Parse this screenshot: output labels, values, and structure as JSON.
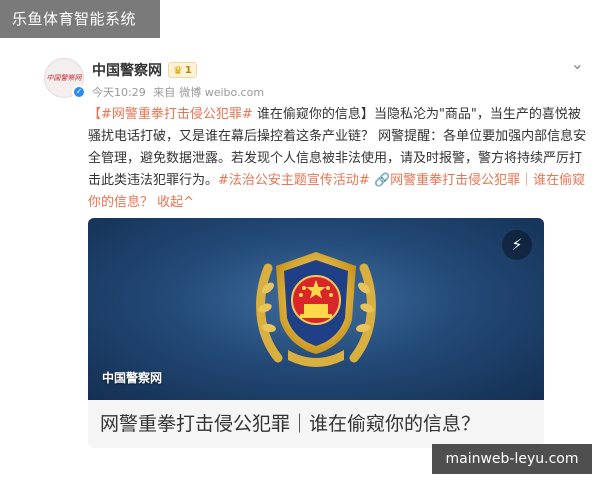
{
  "watermark_top": "乐鱼体育智能系统",
  "watermark_bottom": "mainweb-leyu.com",
  "post": {
    "author": "中国警察网",
    "avatar_logo_text": "中国警察网",
    "badge_text": "1",
    "time": "今天10:29",
    "source_prefix": "来自",
    "source": "微博 weibo.com",
    "body": {
      "hashtag1": "【#网警重拳打击侵公犯罪#",
      "headline": " 谁在偷窥你的信息】",
      "text1": "当隐私沦为\"商品\"，当生产的喜悦被骚扰电话打破，又是谁在幕后操控着这条产业链？ 网警提醒：各单位要加强内部信息安全管理，避免数据泄露。若发现个人信息被非法使用，请及时报警，警方将持续严厉打击此类违法犯罪行为。",
      "hashtag2": "#法治公安主题宣传活动#",
      "link_text": "🔗网警重拳打击侵公犯罪｜谁在偷窥你的信息？",
      "collapse": "收起^"
    },
    "media": {
      "caption": "中国警察网"
    },
    "link_card_title": "网警重拳打击侵公犯罪｜谁在偷窥你的信息？"
  },
  "colors": {
    "accent": "#eb7350",
    "verified": "#2a8cf0",
    "media_bg": "#234a78"
  },
  "icons": {
    "verified": "check",
    "flash": "lightning",
    "more": "chevron-down"
  }
}
